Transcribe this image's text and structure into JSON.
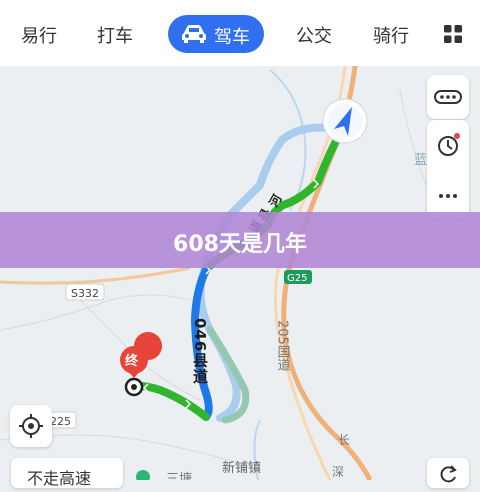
{
  "tabs": {
    "walk": "易行",
    "taxi": "打车",
    "drive": "驾车",
    "bus": "公交",
    "bike": "骑行"
  },
  "map_labels": {
    "road_s332": "S332",
    "road_g25": "G25",
    "road_205": "205国道",
    "road_046": "046县道",
    "road_225": "225",
    "route_char_1": "河",
    "route_char_2": "县",
    "route_char_3": "道",
    "town": "新铺镇",
    "edge_right_top": "蓝",
    "edge_right_bottom_1": "长",
    "edge_right_bottom_2": "深",
    "edge_bottom_mid": "三塘",
    "end_marker": "终"
  },
  "overlay_title": "608天是几年",
  "bottom": {
    "highway_toggle": "不走高速"
  },
  "colors": {
    "tab_active": "#2f6ff0",
    "route_green": "#31b52f",
    "route_blue": "#1f78e8",
    "end_marker": "#e8443a",
    "overlay": "#b086d6"
  },
  "icons": [
    "car-icon",
    "grid-icon",
    "road-condition-icon",
    "history-icon",
    "more-icon",
    "nav-arrow-icon",
    "locate-icon",
    "refresh-icon"
  ]
}
